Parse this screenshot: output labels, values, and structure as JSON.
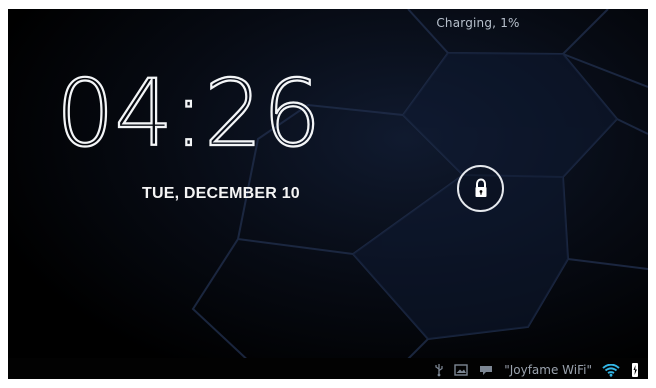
{
  "status_bar": {
    "charging_text": "Charging, 1%"
  },
  "lock_screen": {
    "time": "04:26",
    "date": "TUE, DECEMBER 10",
    "unlock_icon": "lock-icon"
  },
  "system_tray": {
    "network_name": "\"Joyfame WiFi\"",
    "icons": [
      "usb-icon",
      "image-icon",
      "message-icon",
      "wifi-icon",
      "battery-charging-icon"
    ]
  },
  "colors": {
    "background": "#000000",
    "accent_blue": "#33b5e5",
    "clock_text": "#f3f5f7"
  }
}
